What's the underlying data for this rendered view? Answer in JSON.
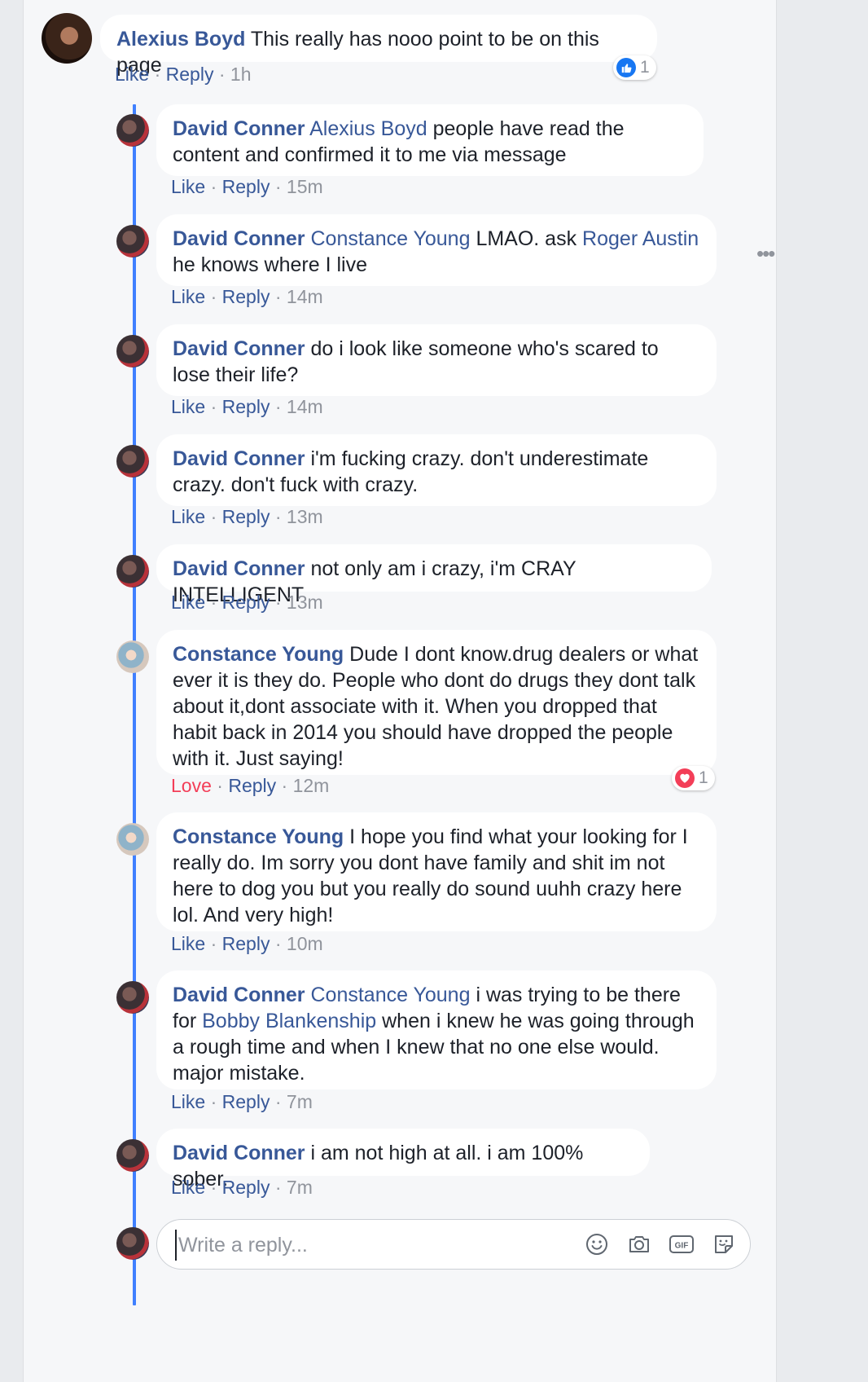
{
  "comments": [
    {
      "author": "Alexius Boyd",
      "mention": "",
      "text": " This really has nooo point to be on this page",
      "like": "Like",
      "reply": "Reply",
      "time": "1h"
    },
    {
      "author": "David Conner",
      "mention": "Alexius Boyd",
      "text": " people have read the content and confirmed it to me via message",
      "like": "Like",
      "reply": "Reply",
      "time": "15m"
    },
    {
      "author": "David Conner",
      "mention": "Constance Young",
      "text": " LMAO. ask ",
      "mention2": "Roger Austin",
      "text2": " he knows where I live",
      "like": "Like",
      "reply": "Reply",
      "time": "14m"
    },
    {
      "author": "David Conner",
      "mention": "",
      "text": " do i look like someone who's scared to lose their life?",
      "like": "Like",
      "reply": "Reply",
      "time": "14m"
    },
    {
      "author": "David Conner",
      "mention": "",
      "text": " i'm fucking crazy. don't underestimate crazy. don't fuck with crazy.",
      "like": "Like",
      "reply": "Reply",
      "time": "13m"
    },
    {
      "author": "David Conner",
      "mention": "",
      "text": " not only am i crazy, i'm CRAY INTELLIGENT",
      "like": "Like",
      "reply": "Reply",
      "time": "13m"
    },
    {
      "author": "Constance Young",
      "mention": "",
      "text": " Dude I dont know.drug dealers or what ever it is they do. People who dont do drugs they dont talk about it,dont associate with it. When you dropped that habit back in 2014 you should have dropped the people with it. Just saying!",
      "like": "Love",
      "reply": "Reply",
      "time": "12m"
    },
    {
      "author": "Constance Young",
      "mention": "",
      "text": " I hope you find what your looking for I really do. Im sorry you dont have family and shit im not here to dog you but you really do sound uuhh crazy here lol. And very high!",
      "like": "Like",
      "reply": "Reply",
      "time": "10m"
    },
    {
      "author": "David Conner",
      "mention": "Constance Young",
      "text": " i was trying to be there for ",
      "mention2": "Bobby Blankenship",
      "text2": " when i knew he was going through a rough time and when I knew that no one else would. major mistake.",
      "like": "Like",
      "reply": "Reply",
      "time": "7m"
    },
    {
      "author": "David Conner",
      "mention": "",
      "text": " i am not high at all. i am 100% sober.",
      "like": "Like",
      "reply": "Reply",
      "time": "7m"
    }
  ],
  "reactions": {
    "like_count": "1",
    "love_count": "1"
  },
  "separator": " · ",
  "reply_box": {
    "placeholder": "Write a reply...",
    "icons": [
      "emoji-icon",
      "camera-icon",
      "gif-icon",
      "sticker-icon"
    ],
    "gif_label": "GIF"
  },
  "colors": {
    "link": "#385898",
    "meta": "#90949c",
    "thread": "#4080ff",
    "love": "#f33e58",
    "like_blue": "#1877f2"
  }
}
